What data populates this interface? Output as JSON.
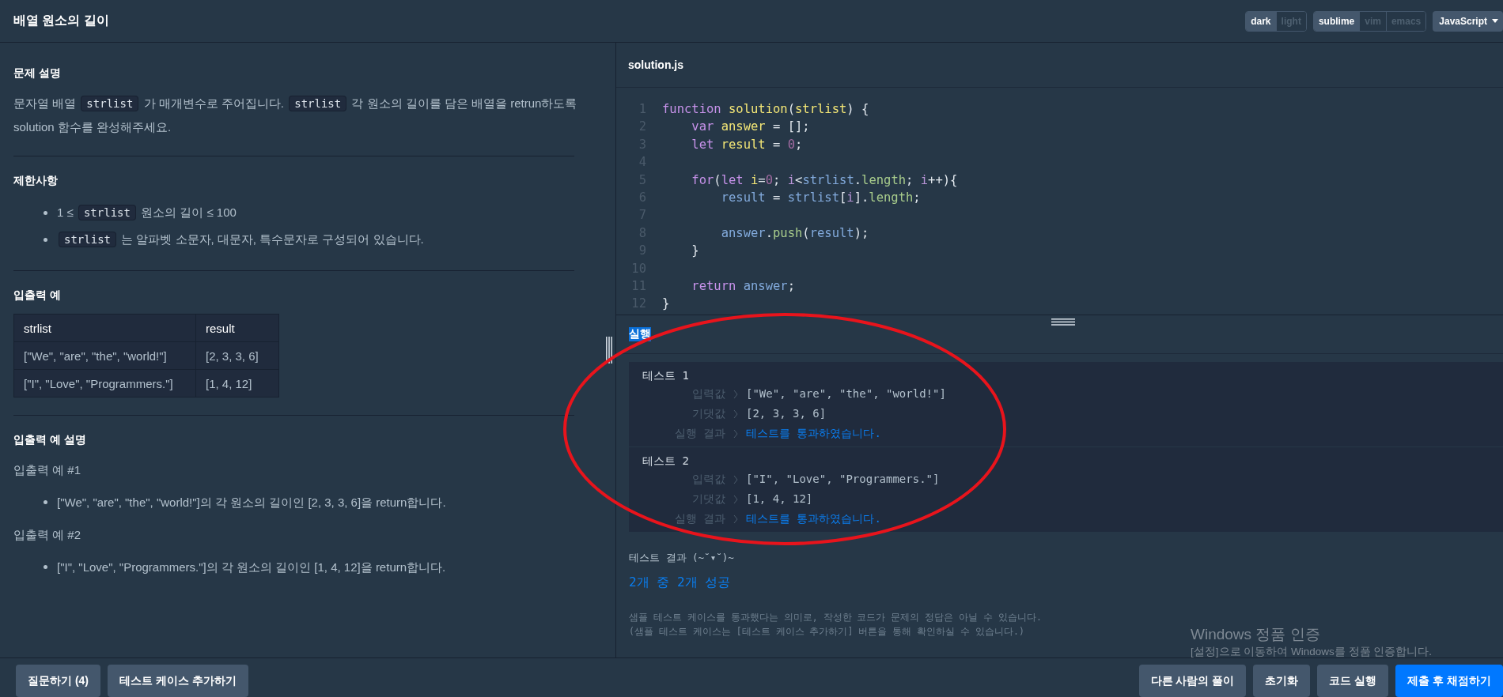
{
  "header": {
    "title": "배열 원소의 길이",
    "toggle_groups": [
      {
        "options": [
          {
            "label": "dark",
            "selected": true
          },
          {
            "label": "light",
            "selected": false
          }
        ]
      },
      {
        "options": [
          {
            "label": "sublime",
            "selected": true
          },
          {
            "label": "vim",
            "selected": false
          },
          {
            "label": "emacs",
            "selected": false
          }
        ]
      }
    ],
    "language_dropdown": {
      "value": "JavaScript"
    }
  },
  "description": {
    "sections": [
      {
        "heading": "문제 설명",
        "blocks": [
          {
            "kind": "paragraph",
            "segments": [
              {
                "text": "문자열 배열 ",
                "code": false
              },
              {
                "text": "strlist",
                "code": true
              },
              {
                "text": " 가 매개변수로 주어집니다. ",
                "code": false
              },
              {
                "text": "strlist",
                "code": true
              },
              {
                "text": " 각 원소의 길이를 담은 배열을 retrun하도록 solution 함수를 완성해주세요.",
                "code": false
              }
            ]
          }
        ]
      },
      {
        "heading": "제한사항",
        "blocks": [
          {
            "kind": "bullets",
            "items": [
              [
                {
                  "text": "1 ≤ ",
                  "code": false
                },
                {
                  "text": "strlist",
                  "code": true
                },
                {
                  "text": " 원소의 길이 ≤ 100",
                  "code": false
                }
              ],
              [
                {
                  "text": "strlist",
                  "code": true
                },
                {
                  "text": " 는 알파벳 소문자, 대문자, 특수문자로 구성되어 있습니다.",
                  "code": false
                }
              ]
            ]
          }
        ]
      },
      {
        "heading": "입출력 예",
        "blocks": [
          {
            "kind": "table",
            "columns": [
              "strlist",
              "result"
            ],
            "rows": [
              [
                "[\"We\", \"are\", \"the\", \"world!\"]",
                "[2, 3, 3, 6]"
              ],
              [
                "[\"I\", \"Love\", \"Programmers.\"]",
                "[1, 4, 12]"
              ]
            ]
          }
        ]
      },
      {
        "heading": "입출력 예 설명",
        "blocks": [
          {
            "kind": "paragraph",
            "segments": [
              {
                "text": "입출력 예 #1",
                "code": false
              }
            ]
          },
          {
            "kind": "bullets",
            "items": [
              [
                {
                  "text": "[\"We\", \"are\", \"the\", \"world!\"]의 각 원소의 길이인 [2, 3, 3, 6]을 return합니다.",
                  "code": false
                }
              ]
            ]
          },
          {
            "kind": "paragraph",
            "segments": [
              {
                "text": "입출력 예 #2",
                "code": false
              }
            ]
          },
          {
            "kind": "bullets",
            "items": [
              [
                {
                  "text": "[\"I\", \"Love\", \"Programmers.\"]의 각 원소의 길이인 [1, 4, 12]을 return합니다.",
                  "code": false
                }
              ]
            ]
          }
        ]
      }
    ]
  },
  "editor": {
    "filename": "solution.js",
    "lines": [
      {
        "number": "1",
        "tokens": [
          {
            "text": "function ",
            "kind": "keyword"
          },
          {
            "text": "solution",
            "kind": "decl"
          },
          {
            "text": "(",
            "kind": "plain"
          },
          {
            "text": "strlist",
            "kind": "decl"
          },
          {
            "text": ") {",
            "kind": "plain"
          }
        ]
      },
      {
        "number": "2",
        "tokens": [
          {
            "text": "    var ",
            "kind": "keyword"
          },
          {
            "text": "answer",
            "kind": "decl"
          },
          {
            "text": " = [];",
            "kind": "plain"
          }
        ]
      },
      {
        "number": "3",
        "tokens": [
          {
            "text": "    let ",
            "kind": "keyword"
          },
          {
            "text": "result",
            "kind": "decl"
          },
          {
            "text": " = ",
            "kind": "plain"
          },
          {
            "text": "0",
            "kind": "number"
          },
          {
            "text": ";",
            "kind": "plain"
          }
        ]
      },
      {
        "number": "4"
      },
      {
        "number": "5",
        "tokens": [
          {
            "text": "    for",
            "kind": "keyword"
          },
          {
            "text": "(",
            "kind": "plain"
          },
          {
            "text": "let ",
            "kind": "keyword"
          },
          {
            "text": "i",
            "kind": "decl"
          },
          {
            "text": "=",
            "kind": "plain"
          },
          {
            "text": "0",
            "kind": "number"
          },
          {
            "text": "; ",
            "kind": "plain"
          },
          {
            "text": "i",
            "kind": "variable"
          },
          {
            "text": "<",
            "kind": "plain"
          },
          {
            "text": "strlist",
            "kind": "ident"
          },
          {
            "text": ".",
            "kind": "plain"
          },
          {
            "text": "length",
            "kind": "property"
          },
          {
            "text": "; ",
            "kind": "plain"
          },
          {
            "text": "i",
            "kind": "variable"
          },
          {
            "text": "++){",
            "kind": "plain"
          }
        ]
      },
      {
        "number": "6",
        "tokens": [
          {
            "text": "        result",
            "kind": "ident"
          },
          {
            "text": " = ",
            "kind": "plain"
          },
          {
            "text": "strlist",
            "kind": "ident"
          },
          {
            "text": "[",
            "kind": "plain"
          },
          {
            "text": "i",
            "kind": "variable"
          },
          {
            "text": "].",
            "kind": "plain"
          },
          {
            "text": "length",
            "kind": "property"
          },
          {
            "text": ";",
            "kind": "plain"
          }
        ]
      },
      {
        "number": "7"
      },
      {
        "number": "8",
        "tokens": [
          {
            "text": "        answer",
            "kind": "ident"
          },
          {
            "text": ".",
            "kind": "plain"
          },
          {
            "text": "push",
            "kind": "property"
          },
          {
            "text": "(",
            "kind": "plain"
          },
          {
            "text": "result",
            "kind": "ident"
          },
          {
            "text": ");",
            "kind": "plain"
          }
        ]
      },
      {
        "number": "9",
        "tokens": [
          {
            "text": "    }",
            "kind": "plain"
          }
        ]
      },
      {
        "number": "10"
      },
      {
        "number": "11",
        "tokens": [
          {
            "text": "    return ",
            "kind": "keyword"
          },
          {
            "text": "answer",
            "kind": "ident"
          },
          {
            "text": ";",
            "kind": "plain"
          }
        ]
      },
      {
        "number": "12",
        "tokens": [
          {
            "text": "}",
            "kind": "plain"
          }
        ]
      }
    ]
  },
  "results": {
    "heading": {
      "text": "실행",
      "highlighted": true
    },
    "tests": [
      {
        "title": "테스트 1",
        "rows": [
          {
            "label": "입력값",
            "value": "[\"We\", \"are\", \"the\", \"world!\"]",
            "kind": "plain"
          },
          {
            "label": "기댓값",
            "value": "[2, 3, 3, 6]",
            "kind": "plain"
          },
          {
            "label": "실행 결과",
            "value": "테스트를 통과하였습니다.",
            "kind": "pass"
          }
        ]
      },
      {
        "title": "테스트 2",
        "rows": [
          {
            "label": "입력값",
            "value": "[\"I\", \"Love\", \"Programmers.\"]",
            "kind": "plain"
          },
          {
            "label": "기댓값",
            "value": "[1, 4, 12]",
            "kind": "plain"
          },
          {
            "label": "실행 결과",
            "value": "테스트를 통과하였습니다.",
            "kind": "pass"
          }
        ]
      }
    ],
    "summary_label": "테스트 결과 (~˘▾˘)~",
    "summary": "2개 중 2개 성공",
    "notes": [
      "샘플 테스트 케이스를 통과했다는 의미로, 작성한 코드가 문제의 정답은 아닐 수 있습니다.",
      "(샘플 테스트 케이스는 [테스트 케이스 추가하기] 버튼을 통해 확인하실 수 있습니다.)"
    ]
  },
  "footer": {
    "left_buttons": [
      {
        "label": "질문하기 (4)",
        "kind": "secondary"
      },
      {
        "label": "테스트 케이스 추가하기",
        "kind": "secondary"
      }
    ],
    "right_buttons": [
      {
        "label": "다른 사람의 풀이",
        "kind": "secondary"
      },
      {
        "label": "초기화",
        "kind": "secondary"
      },
      {
        "label": "코드 실행",
        "kind": "secondary"
      },
      {
        "label": "제출 후 채점하기",
        "kind": "primary"
      }
    ]
  },
  "os_notice": {
    "title": "Windows 정품 인증",
    "text": "[설정]으로 이동하여 Windows를 정품 인증합니다."
  },
  "annotations": [
    {
      "kind": "ellipse"
    }
  ]
}
